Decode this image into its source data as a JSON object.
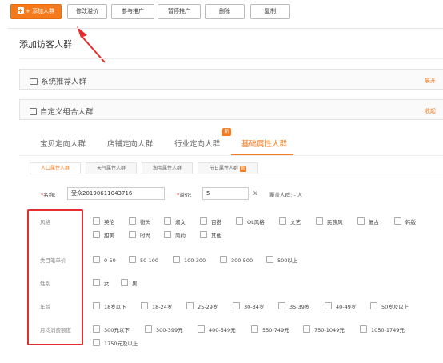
{
  "toolbar": {
    "add_label": "+ 添加人群",
    "modify_price": "修改溢价",
    "join_promo": "参与推广",
    "pause_promo": "暂停推广",
    "delete": "删除",
    "copy": "复制"
  },
  "section_title": "添加访客人群",
  "system_panel": {
    "title": "系统推荐人群",
    "toggle": "展开"
  },
  "custom_panel": {
    "title": "自定义组合人群",
    "toggle": "收起"
  },
  "main_tabs": [
    {
      "label": "宝贝定向人群",
      "active": false
    },
    {
      "label": "店铺定向人群",
      "active": false
    },
    {
      "label": "行业定向人群",
      "active": false,
      "badge": "新"
    },
    {
      "label": "基础属性人群",
      "active": true
    }
  ],
  "sub_tabs": [
    {
      "label": "人口属性人群",
      "active": true
    },
    {
      "label": "天气属性人群",
      "active": false
    },
    {
      "label": "淘宝属性人群",
      "active": false
    },
    {
      "label": "节日属性人群",
      "active": false,
      "badge": "新"
    }
  ],
  "form": {
    "name_label": "名称:",
    "name_value": "受众20190611043716",
    "premium_label": "溢价:",
    "premium_value": "5",
    "unit": "%",
    "coverage": "覆盖人群: - 人"
  },
  "attributes": {
    "style": {
      "label": "风格",
      "options": [
        "英伦",
        "街头",
        "淑女",
        "百搭",
        "OL风格",
        "文艺",
        "民族风",
        "复古",
        "韩版",
        "甜美",
        "时尚",
        "简约",
        "其他"
      ]
    },
    "price": {
      "label": "类目笔单价",
      "options": [
        "0-50",
        "50-100",
        "100-300",
        "300-500",
        "500以上"
      ]
    },
    "gender": {
      "label": "性别",
      "options": [
        "女",
        "男"
      ]
    },
    "age": {
      "label": "年龄",
      "options": [
        "18岁以下",
        "18-24岁",
        "25-29岁",
        "30-34岁",
        "35-39岁",
        "40-49岁",
        "50岁及以上"
      ]
    },
    "spend": {
      "label": "月均消费额度",
      "options": [
        "300元以下",
        "300-399元",
        "400-549元",
        "550-749元",
        "750-1049元",
        "1050-1749元",
        "1750元及以上"
      ]
    }
  }
}
